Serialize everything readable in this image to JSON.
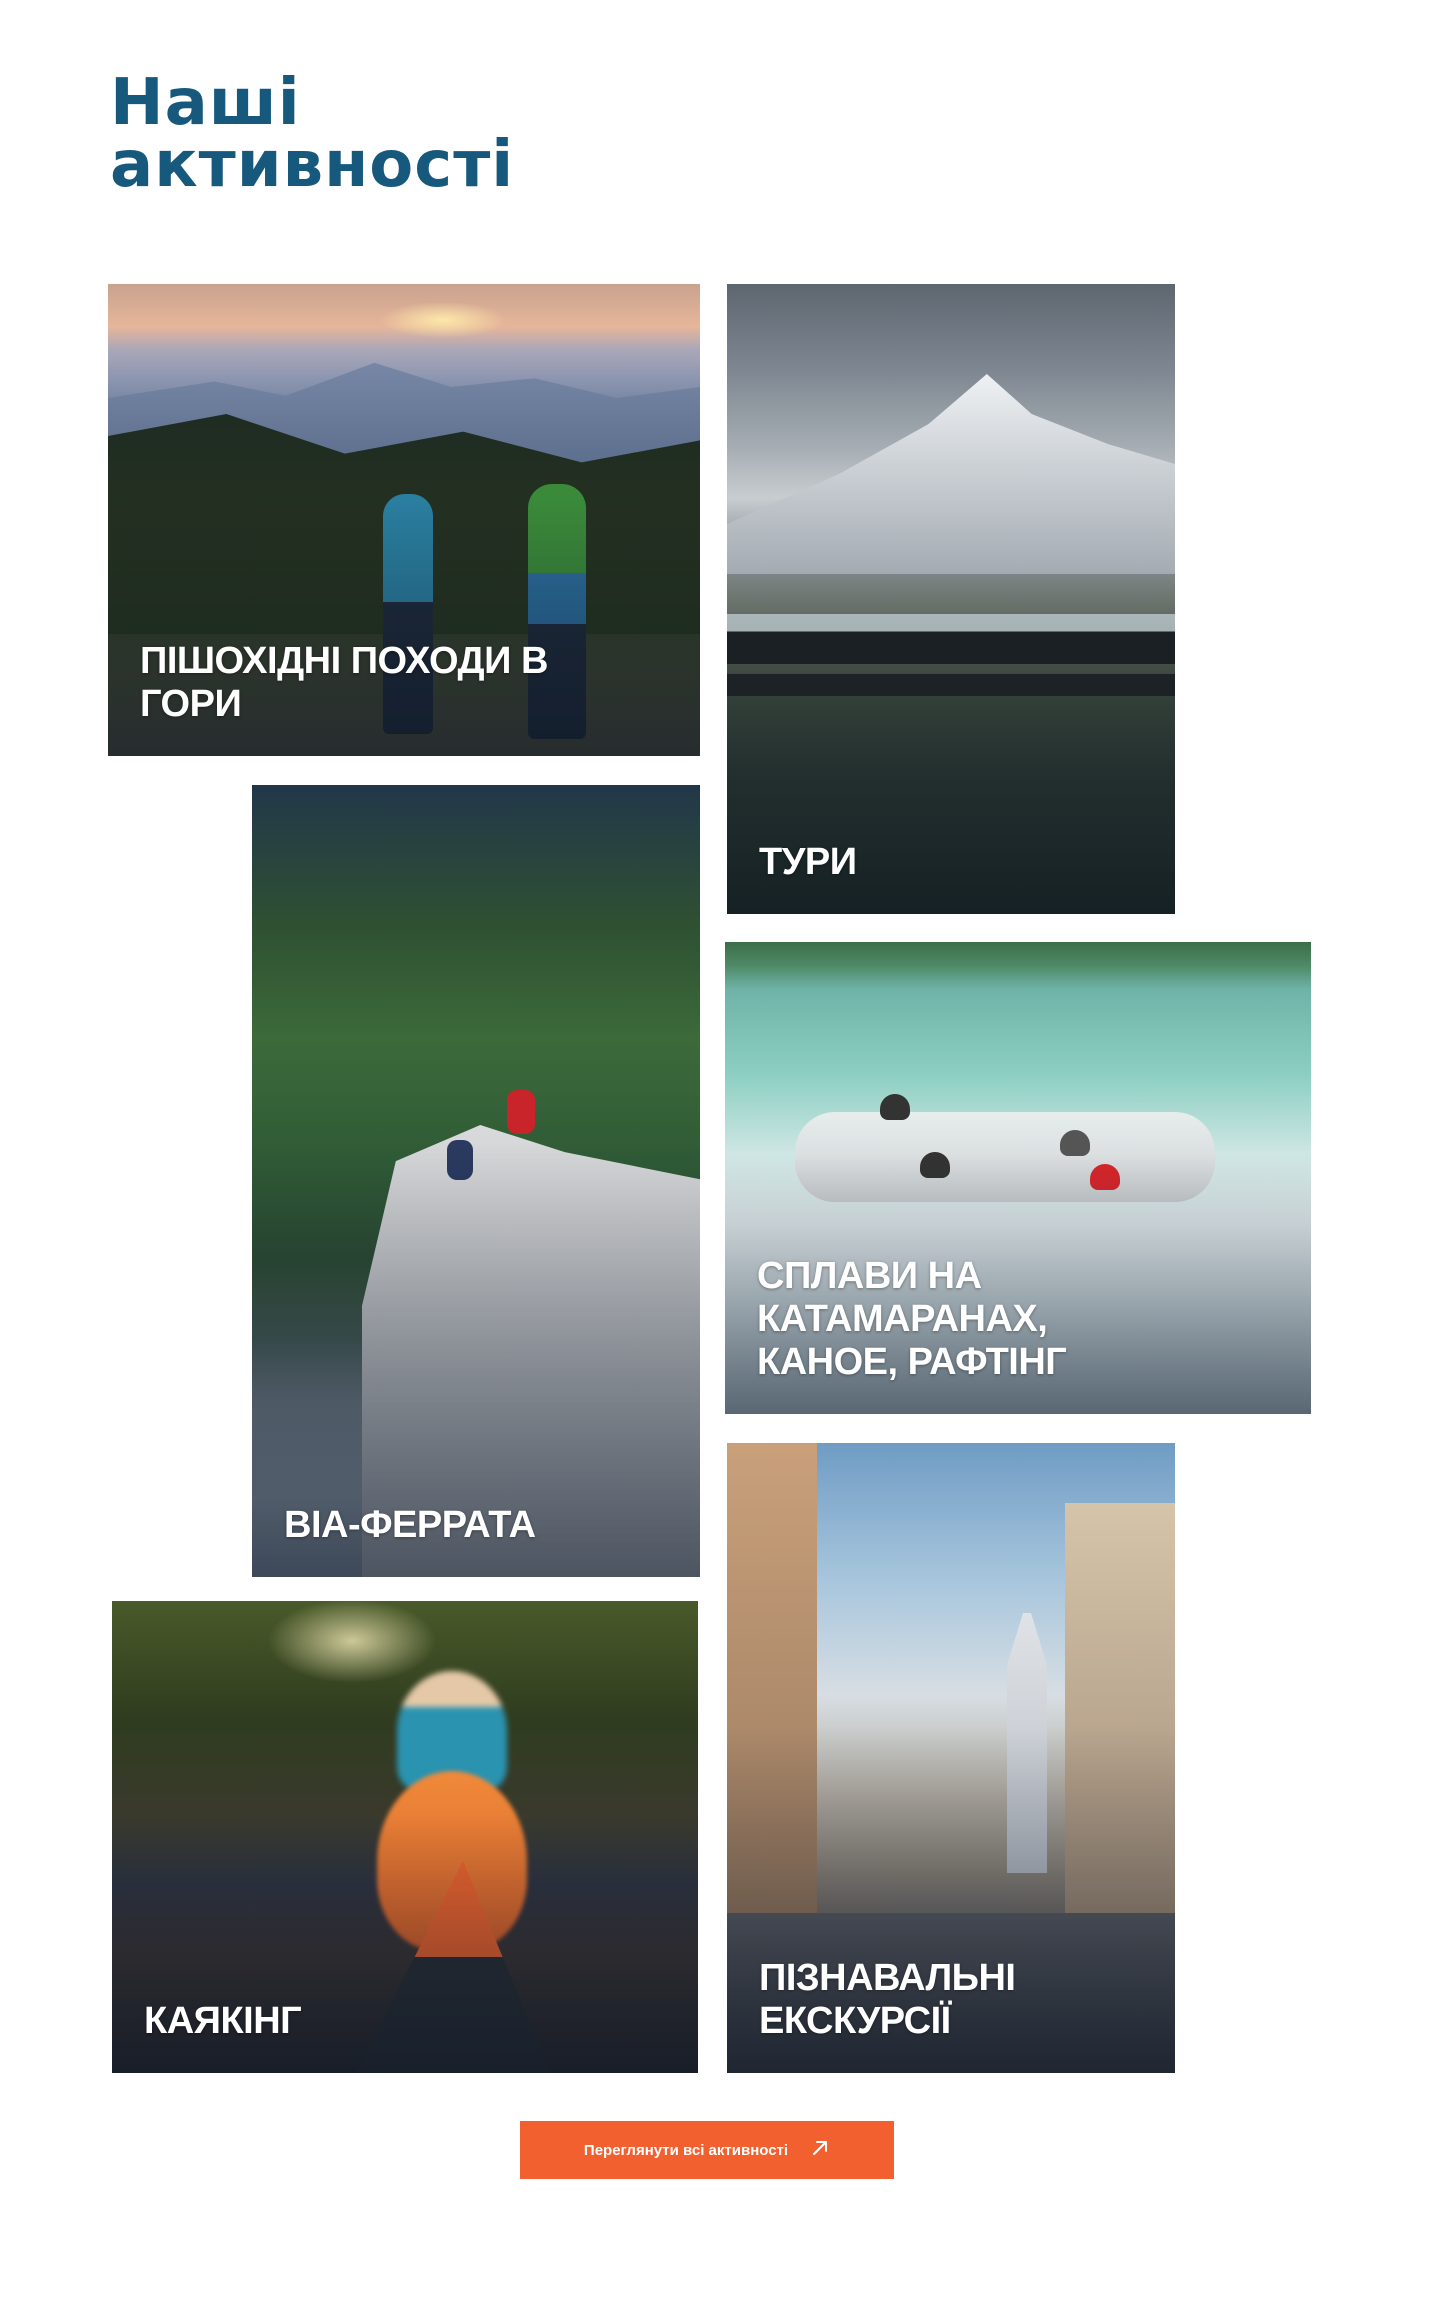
{
  "header": {
    "title_line1": "Наші",
    "title_line2": "активності"
  },
  "activities": [
    {
      "label": "ПІШОХІДНІ ПОХОДИ В\nГОРИ",
      "image": "hikers-at-mountain-sunset"
    },
    {
      "label": "ТУРИ",
      "image": "skywalk-over-mountain-valley"
    },
    {
      "label": "ВІА-ФЕРРАТА",
      "image": "climbers-on-rock-ridge"
    },
    {
      "label": "СПЛАВИ НА\nКАТАМАРАНАХ,\nКАНОЕ, РАФТІНГ",
      "image": "kayakers-in-whitewater"
    },
    {
      "label": "КАЯКІНГ",
      "image": "kayak-on-river"
    },
    {
      "label": "ПІЗНАВАЛЬНІ\nЕКСКУРСІЇ",
      "image": "old-town-street"
    }
  ],
  "cta": {
    "label": "Переглянути всі активності",
    "icon": "arrow-up-right-icon"
  },
  "colors": {
    "title": "#16597d",
    "accent": "#f2602f",
    "card_text": "#ffffff"
  }
}
